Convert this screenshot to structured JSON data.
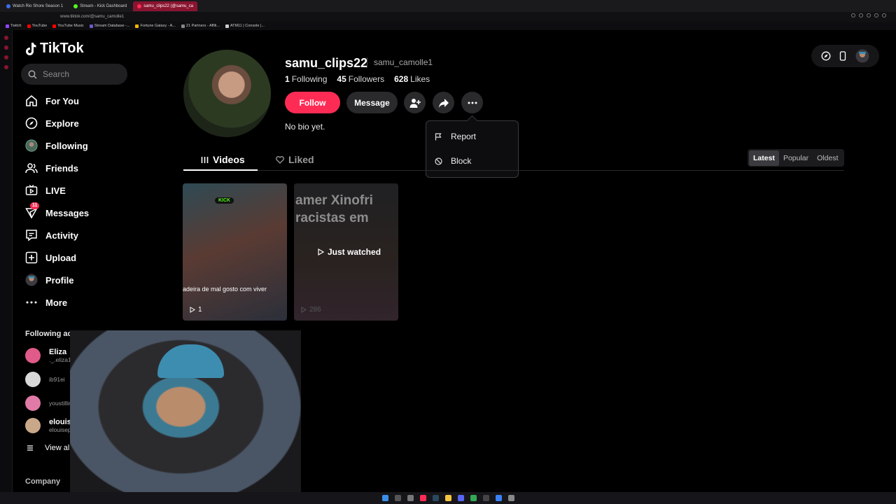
{
  "browser": {
    "tabs": [
      {
        "label": "Watch Rio Shore Season 1",
        "color": "#3a6ee8"
      },
      {
        "label": "Stream - Kick Dashboard",
        "color": "#53fc18"
      },
      {
        "label": "samu_clips22 (@samu_ca",
        "color": "#fe2c55"
      }
    ],
    "url": "www.tiktok.com/@samu_camolle1",
    "bookmarks": [
      {
        "label": "Twitch",
        "color": "#9146ff"
      },
      {
        "label": "YouTube",
        "color": "#ff0000"
      },
      {
        "label": "YouTube Music",
        "color": "#ff0000"
      },
      {
        "label": "Stream Database -...",
        "color": "#6a5acd"
      },
      {
        "label": "Fortune Galaxy - A...",
        "color": "#f5b800"
      },
      {
        "label": "21 Partners - Affili...",
        "color": "#888888"
      },
      {
        "label": "ATM11 | Console |...",
        "color": "#cccccc"
      }
    ]
  },
  "sidebar": {
    "logo": "TikTok",
    "search_placeholder": "Search",
    "nav": [
      {
        "label": "For You",
        "icon": "home-icon"
      },
      {
        "label": "Explore",
        "icon": "compass-icon"
      },
      {
        "label": "Following",
        "icon": "following-avatar-icon"
      },
      {
        "label": "Friends",
        "icon": "friends-icon"
      },
      {
        "label": "LIVE",
        "icon": "live-icon"
      },
      {
        "label": "Messages",
        "icon": "messages-icon",
        "badge": "11"
      },
      {
        "label": "Activity",
        "icon": "activity-icon"
      },
      {
        "label": "Upload",
        "icon": "upload-icon"
      },
      {
        "label": "Profile",
        "icon": "profile-icon"
      },
      {
        "label": "More",
        "icon": "more-icon"
      }
    ],
    "following_title": "Following accounts",
    "following": [
      {
        "name": "Eliza",
        "handle": "._.eliza18",
        "color": "#e05a8a"
      },
      {
        "name": "",
        "handle": "ib91ei",
        "color": "#d8d8d8"
      },
      {
        "name": "",
        "handle": "youstillinmyhead",
        "color": "#e07aa6"
      },
      {
        "name": "elouiseprodigy",
        "handle": "elouiseprodigy",
        "color": "#c9a88a"
      }
    ],
    "view_all": "View all",
    "company": "Company"
  },
  "profile": {
    "username": "samu_clips22",
    "nickname": "samu_camolle1",
    "following_count": "1",
    "following_label": "Following",
    "followers_count": "45",
    "followers_label": "Followers",
    "likes_count": "628",
    "likes_label": "Likes",
    "follow_label": "Follow",
    "message_label": "Message",
    "bio": "No bio yet."
  },
  "more_menu": {
    "items": [
      {
        "label": "Report",
        "icon": "flag-icon"
      },
      {
        "label": "Block",
        "icon": "block-icon"
      }
    ]
  },
  "tabs": {
    "videos": "Videos",
    "liked": "Liked"
  },
  "sort": {
    "options": [
      "Latest",
      "Popular",
      "Oldest"
    ],
    "selected": "Latest"
  },
  "videos": [
    {
      "caption": "adeira de mal gosto com viver",
      "views": "1",
      "overlay_label": "KICK"
    },
    {
      "headline_1": "amer Xinofri",
      "headline_2": "racistas em",
      "status": "Just watched",
      "views": "286"
    }
  ]
}
